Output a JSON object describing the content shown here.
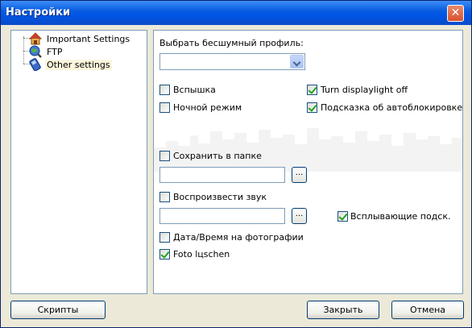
{
  "window": {
    "title": "Настройки",
    "close_label": "✕"
  },
  "tree": {
    "items": [
      {
        "label": "Important Settings"
      },
      {
        "label": "FTP"
      },
      {
        "label": "Other settings"
      }
    ]
  },
  "settings": {
    "silent_profile_label": "Выбрать бесшумный профиль:",
    "silent_profile_value": "",
    "flash_label": "Вспышка",
    "night_mode_label": "Ночной режим",
    "turn_displaylight_off_label": "Turn displaylight off",
    "autolock_hint_label": "Подсказка об автоблокировке",
    "save_in_folder_label": "Сохранить в папке",
    "folder_path_value": "",
    "browse_label": "...",
    "play_sound_label": "Воспроизвести звук",
    "sound_path_value": "",
    "popup_hints_label": "Всплывающие подск.",
    "datetime_on_photo_label": "Дата/Время на фотографии",
    "foto_loschen_label": "Foto lцschen"
  },
  "footer": {
    "scripts_label": "Скрипты",
    "close_label": "Закрыть",
    "cancel_label": "Отмена"
  }
}
